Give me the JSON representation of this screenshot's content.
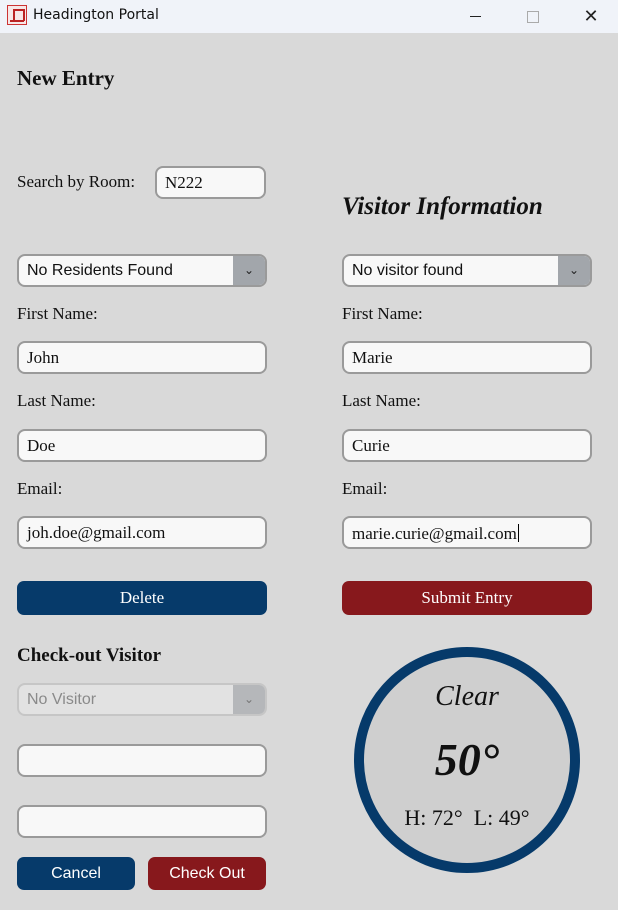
{
  "window": {
    "title": "Headington Portal",
    "minimize": "",
    "maximize": "",
    "close": "✕"
  },
  "new_entry": {
    "heading": "New Entry",
    "search_label": "Search by Room:",
    "room_value": "N222",
    "resident_select": "No Residents Found",
    "first_name_label": "First Name:",
    "first_name_value": "John",
    "last_name_label": "Last Name:",
    "last_name_value": "Doe",
    "email_label": "Email:",
    "email_value": "joh.doe@gmail.com",
    "delete_label": "Delete"
  },
  "visitor": {
    "heading": "Visitor Information",
    "visitor_select": "No visitor found",
    "first_name_label": "First Name:",
    "first_name_value": "Marie",
    "last_name_label": "Last Name:",
    "last_name_value": "Curie",
    "email_label": "Email:",
    "email_value": "marie.curie@gmail.com",
    "submit_label": "Submit Entry"
  },
  "checkout": {
    "heading": "Check-out Visitor",
    "visitor_select": "No Visitor",
    "field1_value": "",
    "field2_value": "",
    "cancel_label": "Cancel",
    "checkout_label": "Check Out"
  },
  "weather": {
    "condition": "Clear",
    "temperature": "50°",
    "high_low": "H: 72°  L: 49°"
  },
  "colors": {
    "primary_blue": "#063a6a",
    "primary_red": "#87181c",
    "background": "#d9d9d9"
  },
  "icons": {
    "app": "headington-logo-icon",
    "dropdown": "chevron-down-icon"
  }
}
